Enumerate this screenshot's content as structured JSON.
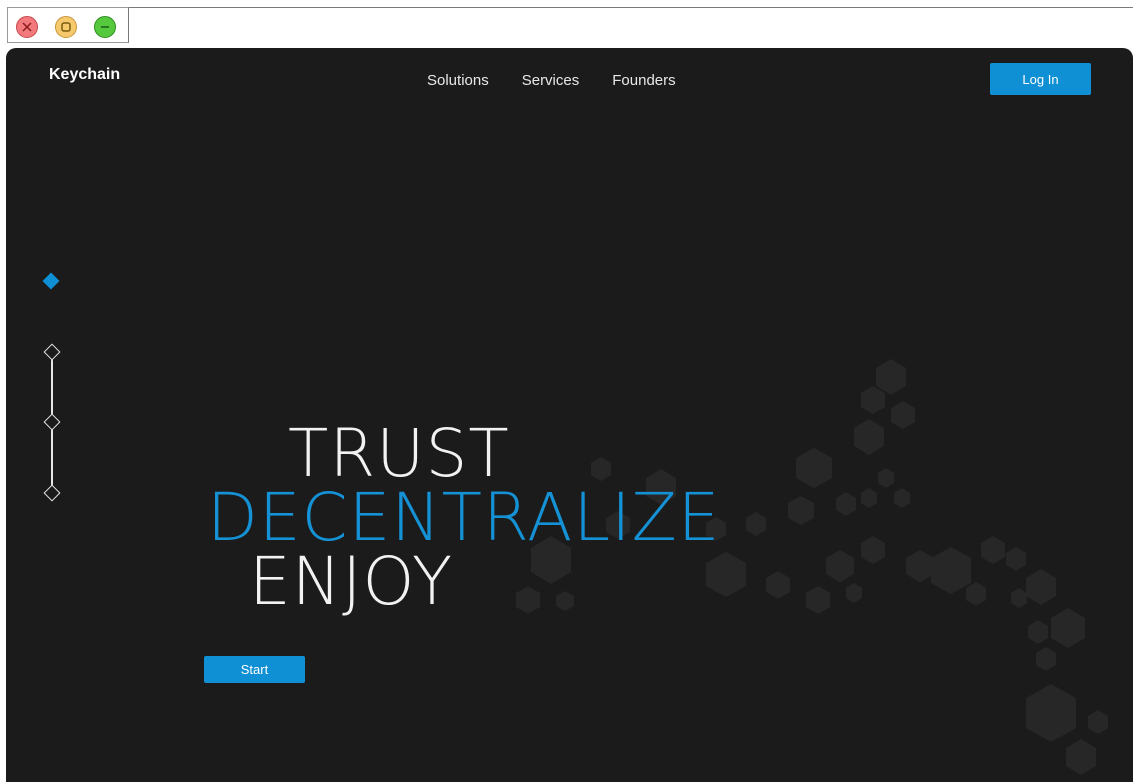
{
  "window": {
    "close_icon": "close-icon",
    "maximize_icon": "maximize-icon",
    "minimize_icon": "minimize-icon"
  },
  "header": {
    "brand": "Keychain",
    "nav": [
      "Solutions",
      "Services",
      "Founders"
    ],
    "login_label": "Log In"
  },
  "hero": {
    "line1": "TRUST",
    "line2": "DECENTRALIZE",
    "line3": "ENJOY",
    "start_label": "Start"
  },
  "slider": {
    "slides": 4,
    "active": 1
  },
  "colors": {
    "accent": "#0f8fd4",
    "background": "#1b1b1c",
    "text": "#f2f2f2"
  }
}
